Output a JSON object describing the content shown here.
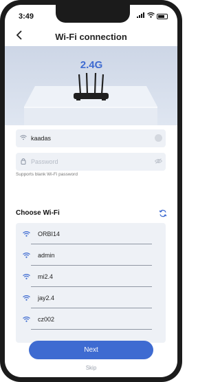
{
  "status_bar": {
    "time": "3:49",
    "signal": ".ıl",
    "wifi": "wifi"
  },
  "nav": {
    "back_glyph": "<",
    "title": "Wi-Fi connection"
  },
  "hero": {
    "band": "2.4G",
    "band_color": "#3e6bd1"
  },
  "ssid_field": {
    "value": "kaadas",
    "icon": "wifi-icon",
    "trail_icon": "clear-icon"
  },
  "password_field": {
    "placeholder": "Password",
    "value": "",
    "icon": "lock-icon",
    "trail_icon": "eye-off-icon"
  },
  "hint": "Supports blank Wi-Fi password",
  "choose": {
    "label": "Choose Wi-Fi",
    "refresh_icon": "refresh-icon"
  },
  "networks": [
    {
      "name": "ORBI14"
    },
    {
      "name": "admin"
    },
    {
      "name": "mi2.4"
    },
    {
      "name": "jay2.4"
    },
    {
      "name": "cz002"
    }
  ],
  "buttons": {
    "next": "Next",
    "skip": "Skip"
  },
  "colors": {
    "accent": "#3e6bd1",
    "field_bg": "#eef1f6",
    "hero_bg": "#d6deeb"
  }
}
